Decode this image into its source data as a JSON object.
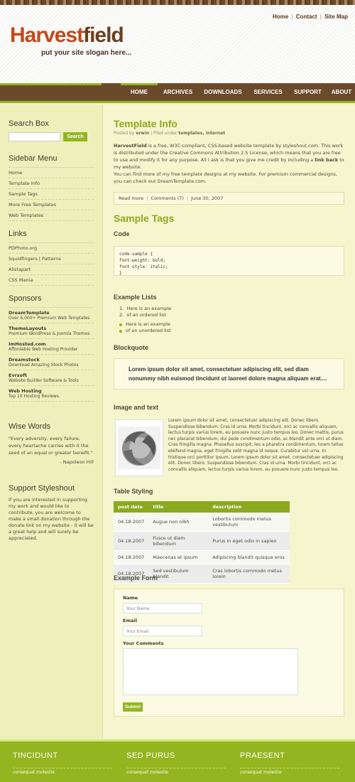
{
  "header": {
    "top_links": [
      "Home",
      "Contact",
      "Site Map"
    ],
    "logo_part1": "Harvest",
    "logo_part2": "field",
    "slogan": "put your site slogan here..."
  },
  "nav": {
    "items": [
      "HOME",
      "ARCHIVES",
      "DOWNLOADS",
      "SERVICES",
      "SUPPORT",
      "ABOUT"
    ],
    "active": "HOME"
  },
  "sidebar": {
    "search_title": "Search Box",
    "search_button": "Search",
    "menu_title": "Sidebar Menu",
    "menu": [
      "Home",
      "Template Info",
      "Sample Tags",
      "More Free Templates",
      "Web Templates"
    ],
    "links_title": "Links",
    "links": [
      "PDPhoto.org",
      "Squidfingers | Patterns",
      "Alistapart",
      "CSS Mania"
    ],
    "sponsors_title": "Sponsors",
    "sponsors": [
      {
        "name": "DreamTemplate",
        "desc": "Over 6,000+ Premium Web Templates"
      },
      {
        "name": "ThemeLayouts",
        "desc": "Premium WordPress & Joomla Themes"
      },
      {
        "name": "ImHosted.com",
        "desc": "Affordable Web Hosting Provider"
      },
      {
        "name": "Dreamstock",
        "desc": "Download Amazing Stock Photos"
      },
      {
        "name": "Evrsoft",
        "desc": "Website Builder Software & Tools"
      },
      {
        "name": "Web Hosting",
        "desc": "Top 10 Hosting Reviews"
      }
    ],
    "wise_title": "Wise Words",
    "quote": "\"Every adversity, every failure, every heartache carries with it the seed of an equal or greater benefit.\"",
    "quote_author": "- Napoleon Hill",
    "support_title": "Support Styleshout",
    "support_text": "If you are interested in supporting my work and would like to contribute, you are welcome to make a small donation through the donate link on my website - it will be a great help and will surely be appreciated."
  },
  "main": {
    "post_title": "Template Info",
    "meta_prefix": "Posted by",
    "meta_author": "erwin",
    "meta_mid": "| Filed under",
    "meta_tags": "templates, internet",
    "para1_bold": "HarvestField",
    "para1_a": " is a free, W3C-compliant, CSS-based website template by styleshout.com. This work is distributed under the Creative Commons Attribution 2.5 License, which means that you are free to use and modify it for any purpose. All I ask is that you give me credit by including a ",
    "para1_link": "link back",
    "para1_b": " to my website.",
    "para2": "You can find more of my free template designs at my website. For premium commercial designs, you can check out DreamTemplate.com.",
    "read_more": "Read more",
    "comments": "Comments (7)",
    "date": "June 30, 2007",
    "sample_title": "Sample Tags",
    "code_title": "Code",
    "code": "code-sample {\nfont-weight: bold;\nfont-style: italic;\n}",
    "lists_title": "Example Lists",
    "ordered": [
      "Here is an example",
      "of an ordered list"
    ],
    "unordered": [
      "Here is an example",
      "of an unordered list"
    ],
    "blockquote_title": "Blockquote",
    "blockquote": "Lorem ipsum dolor sit amet, consectetuer adipiscing elit, sed diam nonummy nibh euismod tincidunt ut laoreet dolore magna aliquam erat....",
    "image_title": "Image and text",
    "image_text": "Lorem ipsum dolor sit amet, consectetuer adipiscing elit. Donec libero. Suspendisse bibendum. Cras id urna. Morbi tincidunt, orci ac convallis aliquam, lectus turpis varius lorem, eu posuere nunc justo tempus leo. Donec mattis, purus nec placerat bibendum, dui pede condimentum odio, ac blandit ante orci ut diam. Cras fringilla magna. Phasellus suscipit, leo a pharetra condimentum, lorem tellus eleifend magna, eget fringilla velit magna id neque. Curabitur vel urna. In tristique orci porttitor ipsum. Lorem ipsum dolor sit amet, consectetuer adipiscing elit. Donec libero. Suspendisse bibendum. Cras id urna. Morbi tincidunt, orci ac convallis aliquam, lectus turpis varius lorem, eu posuere nunc justo tempus leo.",
    "table_title": "Table Styling",
    "table_headers": [
      "post date",
      "title",
      "description"
    ],
    "table_rows": [
      [
        "04.18.2007",
        "Augue non nibh",
        "Lobortis commodo metus vestibulum"
      ],
      [
        "04.18.2007",
        "Fusce ut diam bibendum",
        "Purus in eget odio in sapien"
      ],
      [
        "04.18.2007",
        "Maecenas et ipsum",
        "Adipiscing blandit quisque eros"
      ],
      [
        "04.18.2007",
        "Sed vestibulum blandit",
        "Cras lobortis commodo metus lorem"
      ]
    ],
    "form_title": "Example Form",
    "form_name_label": "Name",
    "form_name_placeholder": "Your Name",
    "form_email_label": "Email",
    "form_email_placeholder": "Your Email",
    "form_comments_label": "Your Comments",
    "form_submit": "Submit"
  },
  "footer": {
    "cols": [
      {
        "title": "TINCIDUNT",
        "sub": "consequat molestie"
      },
      {
        "title": "SED PURUS",
        "sub": "consequat molestie"
      },
      {
        "title": "PRAESENT",
        "sub": "consequat molestie"
      }
    ]
  },
  "colors": {
    "accent_green": "#93b620",
    "brand_brown": "#6b4a2b",
    "logo_orange": "#c2491a"
  }
}
